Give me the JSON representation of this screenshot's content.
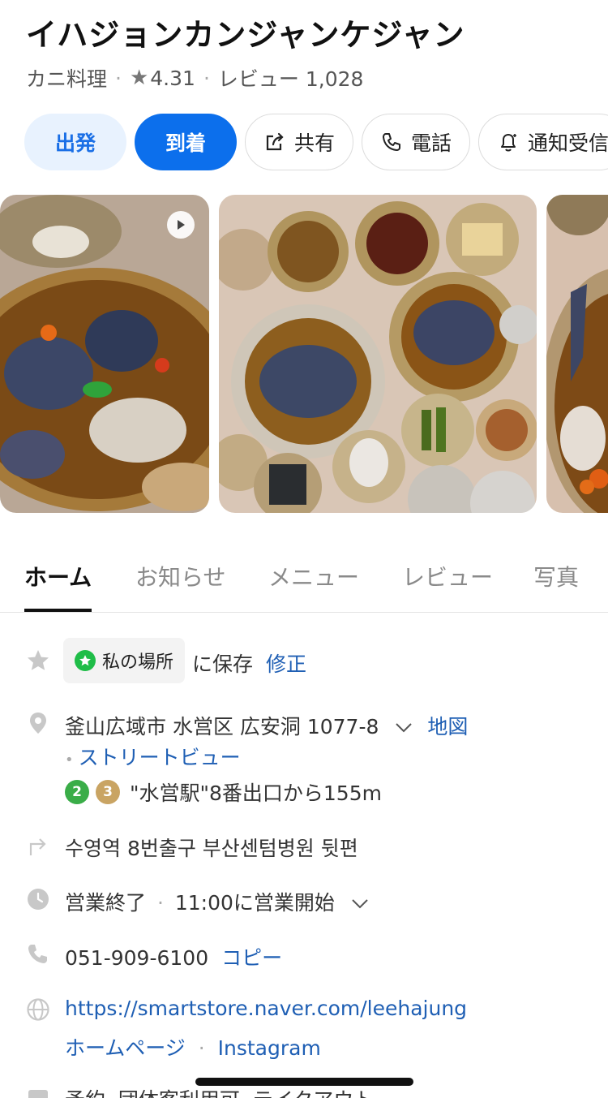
{
  "place": {
    "name": "イハジョンカンジャンケジャン",
    "category": "カニ料理",
    "rating": "4.31",
    "review_label": "レビュー 1,028"
  },
  "actions": {
    "depart": "出発",
    "arrive": "到着",
    "share": "共有",
    "call": "電話",
    "notify": "通知受信"
  },
  "tabs": [
    "ホーム",
    "お知らせ",
    "メニュー",
    "レビュー",
    "写真"
  ],
  "save": {
    "chip_label": "私の場所",
    "suffix": "に保存",
    "edit": "修正"
  },
  "address": {
    "text": "釜山広域市 水営区 広安洞 1077-8",
    "map_link": "地図",
    "street_view": "ストリートビュー"
  },
  "transit": {
    "lines": [
      {
        "label": "2",
        "color": "#3aad48"
      },
      {
        "label": "3",
        "color": "#c9a463"
      }
    ],
    "text": "\"水営駅\"8番出口から155m"
  },
  "directions": "수영역 8번출구 부산센텀병원 뒷편",
  "hours": {
    "status": "営業終了",
    "next": "11:00に営業開始"
  },
  "phone": {
    "number": "051-909-6100",
    "copy": "コピー"
  },
  "web": {
    "url": "https://smartstore.naver.com/leehajung",
    "homepage": "ホームページ",
    "instagram": "Instagram"
  },
  "services": "予約, 団体客利用可, テイクアウト",
  "colors": {
    "accent": "#0c6fec",
    "accent_light": "#e8f2fe",
    "link": "#1f5fb4",
    "saved_green": "#1fbd48"
  }
}
